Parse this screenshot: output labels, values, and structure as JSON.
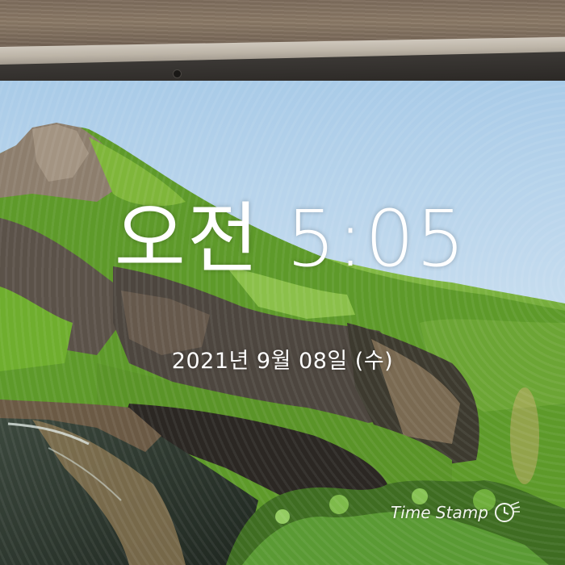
{
  "lock_screen": {
    "time": "오전 5:05",
    "date": "2021년 9월 08일 (수)"
  },
  "watermark": {
    "label": "Time Stamp",
    "icon": "clock-icon"
  },
  "colors": {
    "sky": "#bcd8ee",
    "grass": "#6fae2e",
    "cliff": "#5a5148",
    "sea": "#2f3a2c",
    "text": "#ffffff"
  }
}
